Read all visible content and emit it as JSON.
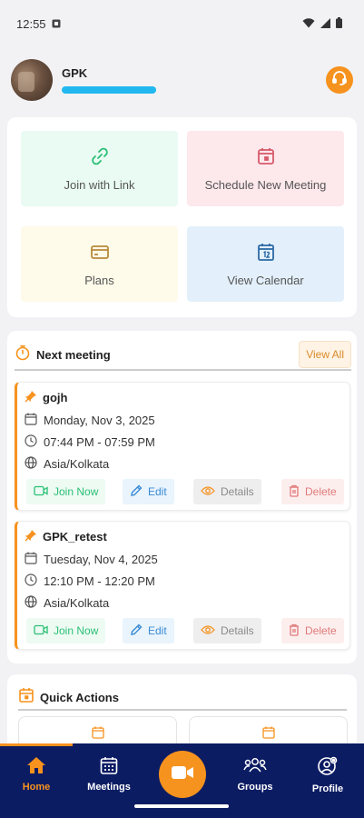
{
  "status_bar": {
    "time": "12:55"
  },
  "header": {
    "user_name": "GPK"
  },
  "tiles": [
    {
      "label": "Join with Link"
    },
    {
      "label": "Schedule New Meeting"
    },
    {
      "label": "Plans"
    },
    {
      "label": "View Calendar"
    }
  ],
  "next_meeting": {
    "title": "Next meeting",
    "view_all": "View All",
    "meetings": [
      {
        "title": "gojh",
        "date": "Monday, Nov 3, 2025",
        "time": "07:44 PM - 07:59 PM",
        "timezone": "Asia/Kolkata"
      },
      {
        "title": "GPK_retest",
        "date": "Tuesday, Nov 4, 2025",
        "time": "12:10 PM - 12:20 PM",
        "timezone": "Asia/Kolkata"
      }
    ],
    "actions": {
      "join": "Join Now",
      "edit": "Edit",
      "details": "Details",
      "delete": "Delete"
    }
  },
  "quick_actions": {
    "title": "Quick Actions"
  },
  "bottom_nav": {
    "items": [
      {
        "label": "Home"
      },
      {
        "label": "Meetings"
      },
      {
        "label": "Groups"
      },
      {
        "label": "Profile"
      }
    ]
  },
  "colors": {
    "accent": "#f6921e",
    "nav_background": "#0c1c63",
    "join": "#2bbf74",
    "edit": "#3a8bd6",
    "delete": "#e07a7a"
  }
}
